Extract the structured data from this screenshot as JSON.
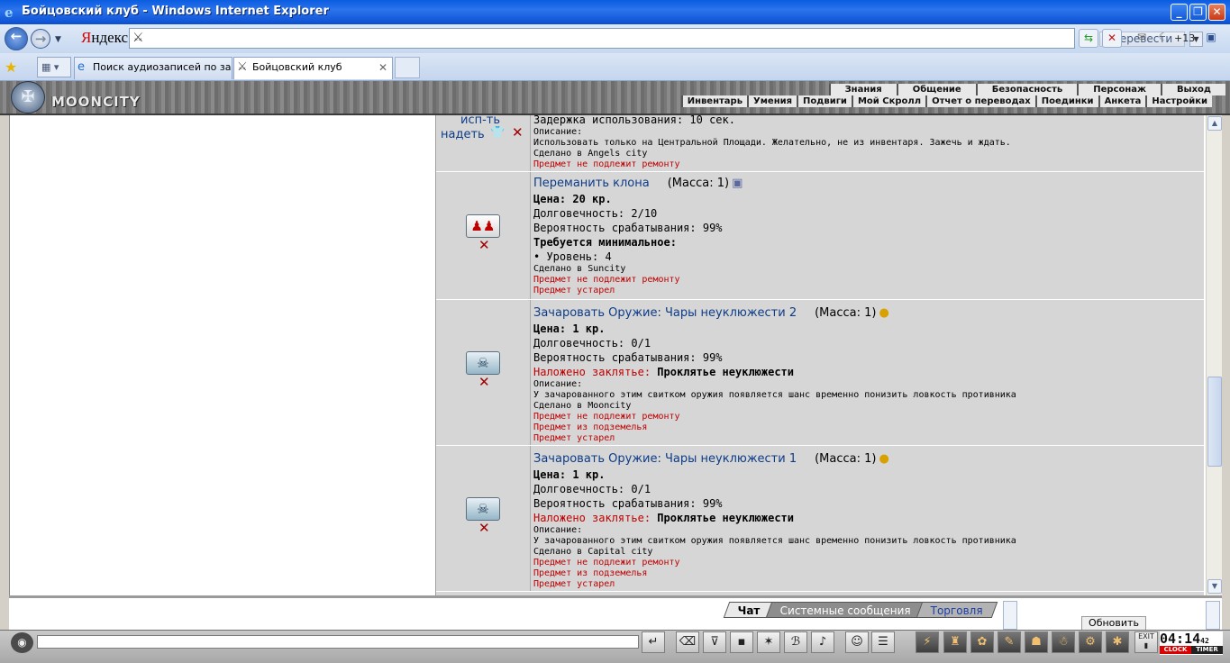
{
  "window": {
    "title": "Бойцовский клуб - Windows Internet Explorer",
    "minimize": "_",
    "restore": "❐",
    "close": "✕"
  },
  "addressbar": {
    "back_icon": "←",
    "forward_icon": "→",
    "search_provider_first": "Я",
    "search_provider_rest": "ндекс",
    "translate_label": "Перевести",
    "notifications_count": "+13"
  },
  "tabs": [
    {
      "label": "Поиск аудиозаписей по зап...",
      "icon": "ie-icon"
    },
    {
      "label": "Бойцовский клуб",
      "icon": "swords-icon",
      "close": "✕"
    }
  ],
  "game": {
    "logo": "MOONCITY",
    "menu_top": [
      "Знания",
      "Общение",
      "Безопасность",
      "Персонаж",
      "Выход"
    ],
    "menu_sub": [
      "Инвентарь",
      "Умения",
      "Подвиги",
      "Мой Скролл",
      "Отчет о переводах",
      "Поединки",
      "Анкета",
      "Настройки"
    ]
  },
  "items": {
    "partial": {
      "use_link": "исп-ть",
      "wear_link": "надеть",
      "lines": [
        {
          "text": "Задержка использования: 10 сек.",
          "style": "big"
        },
        {
          "text": "Описание:",
          "style": "normal"
        },
        {
          "text": "Использовать только на Центральной Площади. Желательно, не из инвентаря. Зажечь и ждать.",
          "style": "normal"
        },
        {
          "text": "Сделано в Angels city",
          "style": "normal"
        },
        {
          "text": "Предмет не подлежит ремонту",
          "style": "red"
        }
      ]
    },
    "clone": {
      "name": "Переманить клона",
      "mass": "(Масса: 1)",
      "lines": [
        {
          "text": "Цена: 20 кр.",
          "style": "bold"
        },
        {
          "text": "Долговечность: 2/10",
          "style": "big"
        },
        {
          "text": "Вероятность срабатывания: 99%",
          "style": "big"
        },
        {
          "text": "Требуется минимальное:",
          "style": "bold"
        },
        {
          "text": "• Уровень: 4",
          "style": "big"
        },
        {
          "text": "Сделано в Suncity",
          "style": "normal"
        },
        {
          "text": "Предмет не подлежит ремонту",
          "style": "red"
        },
        {
          "text": "Предмет устарел",
          "style": "red"
        }
      ]
    },
    "clumsy2": {
      "name": "Зачаровать Оружие: Чары неуклюжести 2",
      "mass": "(Масса: 1)",
      "price": "Цена: 1 кр.",
      "durability": "Долговечность: 0/1",
      "chance": "Вероятность срабатывания: 99%",
      "spell_label": "Наложено заклятье:",
      "spell_name": "Проклятье неуклюжести",
      "desc_label": "Описание:",
      "desc": "У зачарованного этим свитком оружия появляется шанс временно понизить ловкость противника",
      "made": "Сделано в Mooncity",
      "red1": "Предмет не подлежит ремонту",
      "red2": "Предмет из подземелья",
      "red3": "Предмет устарел"
    },
    "clumsy1": {
      "name": "Зачаровать Оружие: Чары неуклюжести 1",
      "mass": "(Масса: 1)",
      "price": "Цена: 1 кр.",
      "durability": "Долговечность: 0/1",
      "chance": "Вероятность срабатывания: 99%",
      "spell_label": "Наложено заклятье:",
      "spell_name": "Проклятье неуклюжести",
      "desc_label": "Описание:",
      "desc": "У зачарованного этим свитком оружия появляется шанс временно понизить ловкость противника",
      "made": "Сделано в Capital city",
      "red1": "Предмет не подлежит ремонту",
      "red2": "Предмет из подземелья",
      "red3": "Предмет устарел"
    }
  },
  "chat": {
    "tabs": [
      "Чат",
      "Системные сообщения",
      "Торговля"
    ],
    "refresh": "Обновить"
  },
  "clock": {
    "time": "04:14",
    "seconds": "42",
    "label_clock": "CLOCK",
    "label_timer": "TIMER",
    "exit_label": "EXIT"
  }
}
